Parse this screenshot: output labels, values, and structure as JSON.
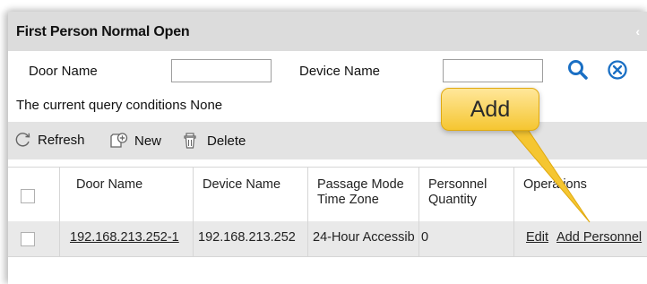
{
  "window": {
    "title": "First Person Normal Open"
  },
  "search": {
    "door_name_label": "Door Name",
    "door_name_value": "",
    "device_name_label": "Device Name",
    "device_name_value": ""
  },
  "query": {
    "prefix": "The current query conditions",
    "value": "None"
  },
  "toolbar": {
    "refresh_label": "Refresh",
    "new_label": "New",
    "delete_label": "Delete"
  },
  "table": {
    "columns": [
      "Door Name",
      "Device Name",
      "Passage Mode Time Zone",
      "Personnel Quantity",
      "Operations"
    ],
    "column_lines": [
      [
        "Door Name"
      ],
      [
        "Device Name"
      ],
      [
        "Passage Mode",
        "Time Zone"
      ],
      [
        "Personnel",
        "Quantity"
      ],
      [
        "Operations"
      ]
    ],
    "rows": [
      {
        "door_name": "192.168.213.252-1",
        "device_name": "192.168.213.252",
        "passage_mode_time_zone": "24-Hour Accessib",
        "personnel_quantity": "0",
        "op_edit": "Edit",
        "op_add_personnel": "Add Personnel"
      }
    ]
  },
  "tooltip": {
    "text": "Add"
  },
  "icons": {
    "search": "search-icon",
    "clear": "clear-circle-x-icon",
    "refresh": "refresh-icon",
    "new": "new-document-icon",
    "delete": "delete-trash-icon"
  },
  "colors": {
    "accent": "#1a6fc4",
    "tooltip": "#f5c631",
    "header_bg": "#dcdcdc"
  }
}
